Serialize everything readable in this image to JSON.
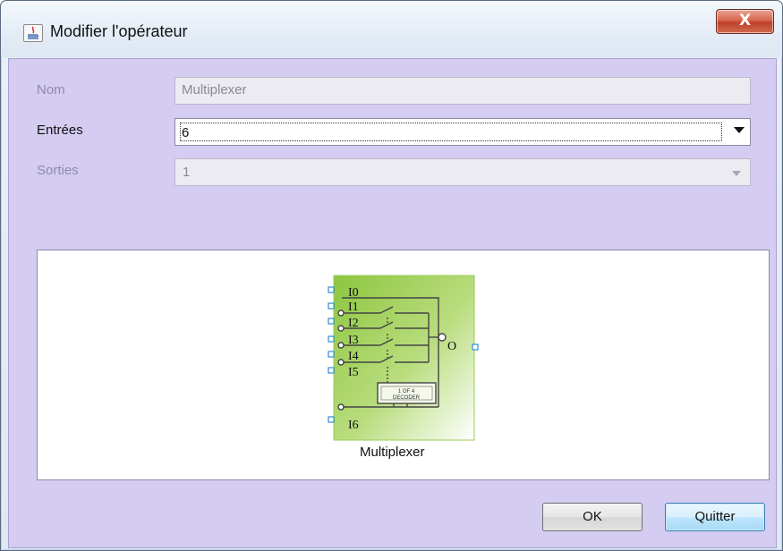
{
  "window": {
    "title": "Modifier l'opérateur",
    "close_label": "X"
  },
  "form": {
    "nom_label": "Nom",
    "nom_value": "Multiplexer",
    "entrees_label": "Entrées",
    "entrees_value": "6",
    "sorties_label": "Sorties",
    "sorties_value": "1"
  },
  "preview": {
    "operator_name": "Multiplexer",
    "inputs": [
      "I0",
      "I1",
      "I2",
      "I3",
      "I4",
      "I5",
      "I6"
    ],
    "output": "O",
    "decoder_line1": "1 OF 4",
    "decoder_line2": "DECODER"
  },
  "buttons": {
    "ok_label": "OK",
    "quit_label": "Quitter"
  },
  "colors": {
    "client_background": "#d5ccf2",
    "operator_gradient_start": "#8dc63f",
    "operator_gradient_end": "#ffffff",
    "port_color": "#2b8fd6"
  }
}
